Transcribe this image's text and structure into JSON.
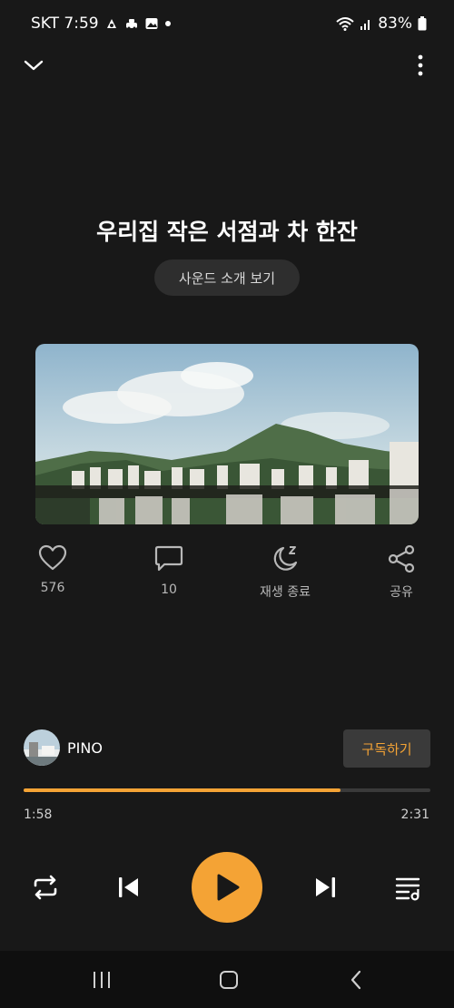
{
  "status": {
    "carrier_time": "SKT 7:59",
    "battery": "83%",
    "icons": [
      "aliexpress-icon",
      "taxi-icon",
      "gallery-icon",
      "dot-icon",
      "wifi-icon",
      "signal-icon",
      "battery-icon"
    ]
  },
  "header": {
    "collapse_icon": "chevron-down-icon",
    "more_icon": "more-vertical-icon"
  },
  "track": {
    "title": "우리집 작은 서점과 차 한잔",
    "intro_button": "사운드 소개 보기"
  },
  "actions": [
    {
      "icon": "heart-icon",
      "label": "576"
    },
    {
      "icon": "comment-icon",
      "label": "10"
    },
    {
      "icon": "sleep-timer-icon",
      "label": "재생 종료"
    },
    {
      "icon": "share-icon",
      "label": "공유"
    }
  ],
  "artist": {
    "name": "PINO",
    "subscribe_label": "구독하기"
  },
  "player": {
    "elapsed": "1:58",
    "duration": "2:31",
    "progress": 0.78,
    "accent_color": "#f4a335"
  },
  "controls": [
    "repeat-icon",
    "previous-icon",
    "play-icon",
    "next-icon",
    "playlist-icon"
  ],
  "system_nav": [
    "recents-icon",
    "home-icon",
    "back-icon"
  ]
}
